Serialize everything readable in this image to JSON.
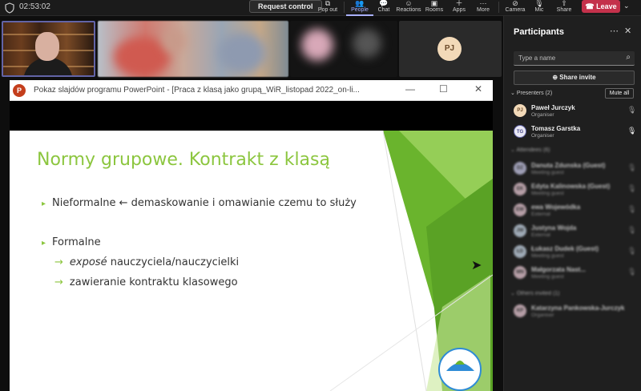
{
  "topbar": {
    "timer": "02:53:02",
    "request_control": "Request control",
    "pop_out": "Pop out",
    "people": "People",
    "chat": "Chat",
    "reactions": "Reactions",
    "rooms": "Rooms",
    "apps": "Apps",
    "more": "More",
    "camera": "Camera",
    "mic": "Mic",
    "share": "Share",
    "leave": "Leave"
  },
  "video": {
    "pj_initials": "PJ"
  },
  "ppt": {
    "window_title": "Pokaz slajdów programu PowerPoint - [Praca z klasą jako grupą_WiR_listopad 2022_on-li...",
    "slide_title": "Normy grupowe. Kontrakt z klasą",
    "bullet1": "Nieformalne ← demaskowanie i omawianie czemu to służy",
    "bullet2": "Formalne",
    "sub1_em": "exposé",
    "sub1_rest": " nauczyciela/nauczycielki",
    "sub2": "zawieranie kontraktu klasowego"
  },
  "panel": {
    "title": "Participants",
    "search_placeholder": "Type a name",
    "share_invite": "Share invite",
    "presenters_label": "Presenters (2)",
    "mute_all": "Mute all",
    "presenters": [
      {
        "initials": "PJ",
        "name": "Paweł Jurczyk",
        "role": "Organiser",
        "color": "#f2d9b8",
        "fg": "#6b4a2a"
      },
      {
        "initials": "TG",
        "name": "Tomasz Garstka",
        "role": "Organiser",
        "color": "#e8e8f4",
        "fg": "#4a4a8a"
      }
    ],
    "attendees_label": "Attendees (6)",
    "attendees": [
      {
        "initials": "DZ",
        "name": "Danuta Zdunska (Guest)",
        "role": "Meeting guest",
        "color": "#c9c9e8"
      },
      {
        "initials": "EK",
        "name": "Edyta Kalinowska (Guest)",
        "role": "Meeting guest",
        "color": "#e8c9d4"
      },
      {
        "initials": "EW",
        "name": "ewa Wojewódka",
        "role": "External",
        "color": "#e8c9d4"
      },
      {
        "initials": "JW",
        "name": "Justyna Wojda",
        "role": "External",
        "color": "#c9d8e8"
      },
      {
        "initials": "ŁD",
        "name": "Łukasz Dudek (Guest)",
        "role": "Meeting guest",
        "color": "#c9d8e8"
      },
      {
        "initials": "MN",
        "name": "Małgorzata Nast...",
        "role": "Meeting guest",
        "color": "#e8c9d4"
      }
    ],
    "others_label": "Others invited (1)",
    "others": [
      {
        "initials": "KP",
        "name": "Katarzyna Pankowska-Jurczyk",
        "role": "Organiser",
        "color": "#e8c9d4"
      }
    ]
  }
}
